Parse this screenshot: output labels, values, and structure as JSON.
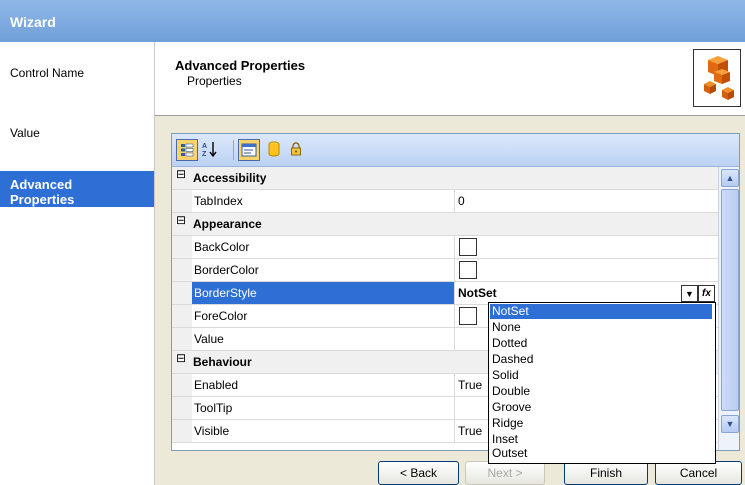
{
  "window": {
    "title": "Wizard"
  },
  "nav": {
    "items": [
      {
        "label": "Control Name"
      },
      {
        "label": "Value"
      },
      {
        "label": "Advanced Properties"
      }
    ]
  },
  "header": {
    "title": "Advanced Properties",
    "subtitle": "Properties"
  },
  "grid": {
    "categories": {
      "accessibility": "Accessibility",
      "appearance": "Appearance",
      "behaviour": "Behaviour"
    },
    "expand_glyph": "⊟",
    "props": {
      "tabindex": {
        "name": "TabIndex",
        "value": "0"
      },
      "backcolor": {
        "name": "BackColor"
      },
      "bordercolor": {
        "name": "BorderColor"
      },
      "borderstyle": {
        "name": "BorderStyle",
        "value": "NotSet"
      },
      "forecolor": {
        "name": "ForeColor"
      },
      "value": {
        "name": "Value"
      },
      "enabled": {
        "name": "Enabled",
        "value": "True"
      },
      "tooltip": {
        "name": "ToolTip"
      },
      "visible": {
        "name": "Visible",
        "value": "True"
      }
    },
    "fx_label": "fx"
  },
  "dropdown": {
    "options": [
      "NotSet",
      "None",
      "Dotted",
      "Dashed",
      "Solid",
      "Double",
      "Groove",
      "Ridge",
      "Inset",
      "Outset"
    ],
    "selected": "NotSet"
  },
  "footer": {
    "back": "< Back",
    "next": "Next >",
    "finish": "Finish",
    "cancel": "Cancel"
  },
  "colors": {
    "accent": "#2e6fd6",
    "titlebar": "#7fabe0",
    "content_bg": "#ece9d8"
  }
}
